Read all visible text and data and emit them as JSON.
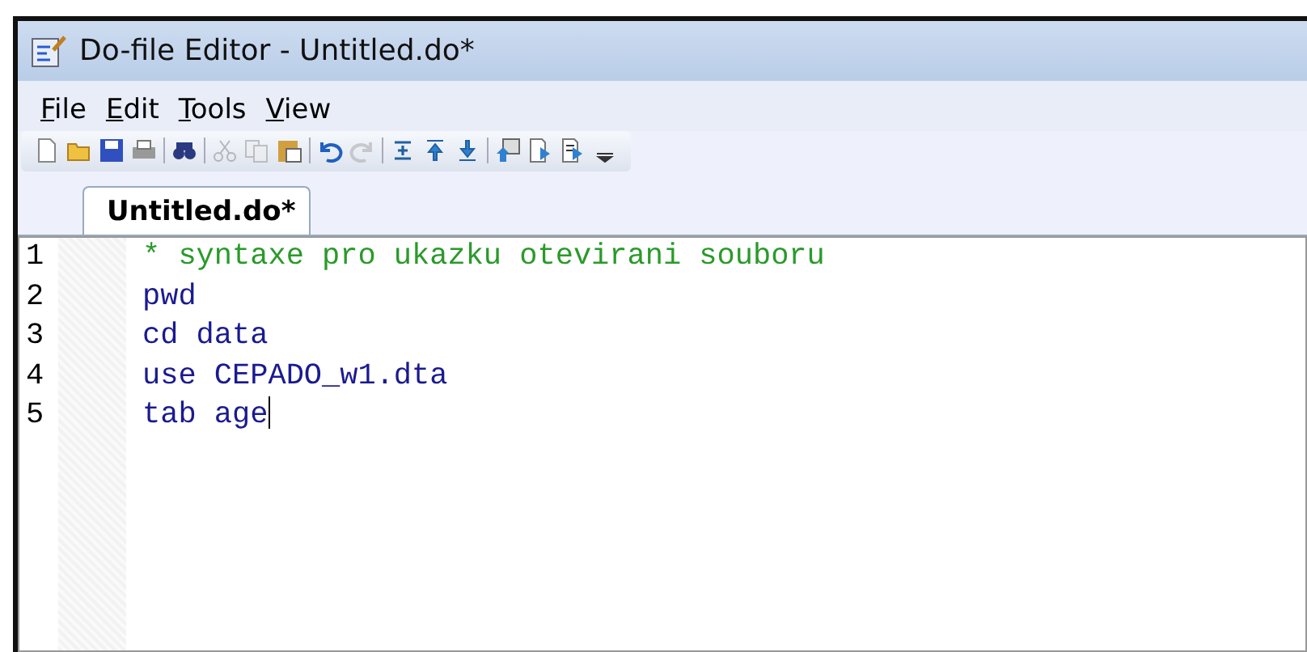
{
  "window": {
    "title": "Do-file Editor - Untitled.do*"
  },
  "menu": [
    {
      "label": "File"
    },
    {
      "label": "Edit"
    },
    {
      "label": "Tools"
    },
    {
      "label": "View"
    }
  ],
  "toolbar": [
    {
      "kind": "new",
      "disabled": false
    },
    {
      "kind": "open",
      "disabled": false
    },
    {
      "kind": "save",
      "disabled": false
    },
    {
      "kind": "print",
      "disabled": false
    },
    {
      "kind": "sep"
    },
    {
      "kind": "find",
      "disabled": false
    },
    {
      "kind": "sep"
    },
    {
      "kind": "cut",
      "disabled": true
    },
    {
      "kind": "copy",
      "disabled": true
    },
    {
      "kind": "paste",
      "disabled": false
    },
    {
      "kind": "sep"
    },
    {
      "kind": "undo",
      "disabled": false
    },
    {
      "kind": "redo",
      "disabled": true
    },
    {
      "kind": "sep"
    },
    {
      "kind": "bookmark",
      "disabled": false
    },
    {
      "kind": "prev",
      "disabled": false
    },
    {
      "kind": "next",
      "disabled": false
    },
    {
      "kind": "sep"
    },
    {
      "kind": "up",
      "disabled": false
    },
    {
      "kind": "run",
      "disabled": false
    },
    {
      "kind": "runsel",
      "disabled": false
    },
    {
      "kind": "more",
      "disabled": false
    }
  ],
  "tabs": [
    {
      "label": "Untitled.do*",
      "selected": true
    }
  ],
  "editor": {
    "lines": [
      {
        "number": "1",
        "kind": "comment",
        "text": "* syntaxe pro ukazku otevirani souboru",
        "cursor": false
      },
      {
        "number": "2",
        "kind": "code",
        "text": "pwd",
        "cursor": false
      },
      {
        "number": "3",
        "kind": "code",
        "text": "cd data",
        "cursor": false
      },
      {
        "number": "4",
        "kind": "code",
        "text": "use CEPADO_w1.dta",
        "cursor": false
      },
      {
        "number": "5",
        "kind": "code",
        "text": "tab age",
        "cursor": true
      }
    ]
  }
}
